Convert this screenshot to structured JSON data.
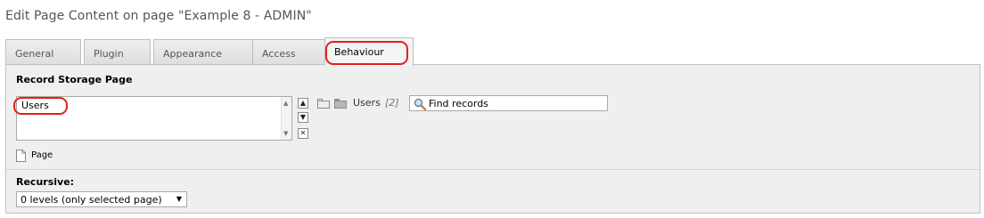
{
  "page_title": "Edit Page Content on page \"Example 8 - ADMIN\"",
  "tabs": [
    {
      "label": "General"
    },
    {
      "label": "Plugin"
    },
    {
      "label": "Appearance"
    },
    {
      "label": "Access"
    },
    {
      "label": "Behaviour"
    }
  ],
  "storage": {
    "label": "Record Storage Page",
    "selected_item": "Users",
    "folder_link_label": "Users",
    "folder_link_count": "[2]",
    "find_placeholder": "Find records",
    "page_label": "Page"
  },
  "recursive": {
    "label": "Recursive:",
    "selected": "0 levels (only selected page)"
  }
}
